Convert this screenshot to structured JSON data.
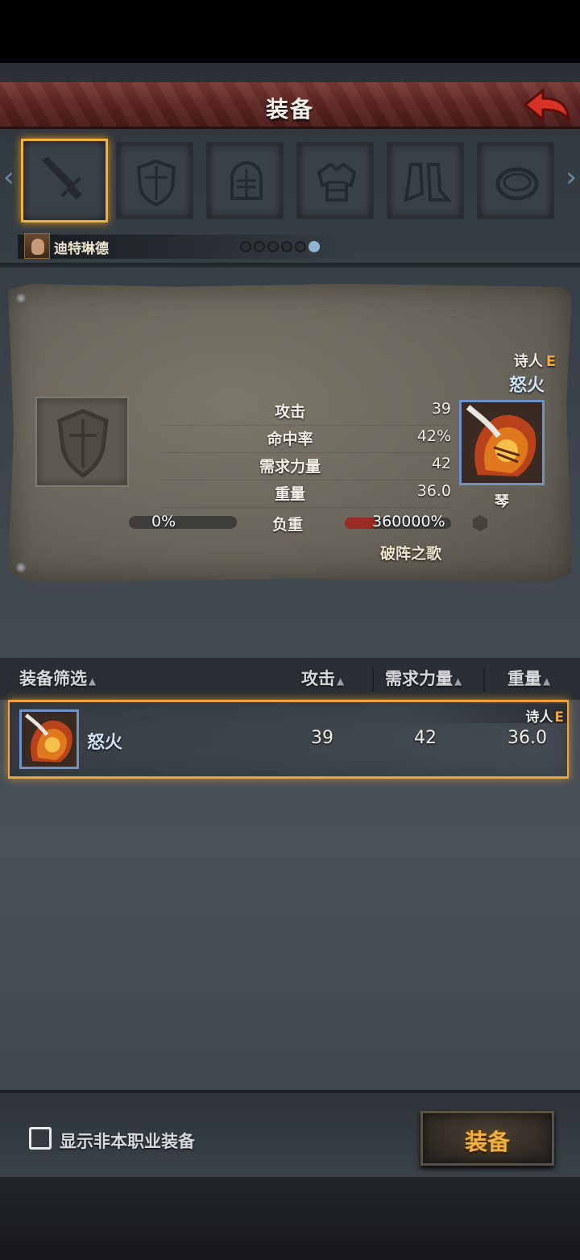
{
  "header": {
    "title": "装备",
    "back_icon": "back-arrow-icon"
  },
  "slots": [
    {
      "icon": "sword-icon",
      "active": true
    },
    {
      "icon": "shield-icon",
      "active": false
    },
    {
      "icon": "helmet-icon",
      "active": false
    },
    {
      "icon": "armor-icon",
      "active": false
    },
    {
      "icon": "boots-icon",
      "active": false
    },
    {
      "icon": "ring-icon",
      "active": false
    }
  ],
  "character": {
    "name": "迪特琳德",
    "page_dots": 6,
    "active_dot": 6
  },
  "detail": {
    "class_name": "诗人",
    "class_grade": "E",
    "item_name": "怒火",
    "item_type": "琴",
    "stats": [
      {
        "label": "攻击",
        "value": "39"
      },
      {
        "label": "命中率",
        "value": "42%"
      },
      {
        "label": "需求力量",
        "value": "42"
      },
      {
        "label": "重量",
        "value": "36.0"
      }
    ],
    "load": {
      "label": "负重",
      "current": "0%",
      "after": "360000%"
    },
    "set_name": "破阵之歌"
  },
  "list": {
    "headers": {
      "filter": "装备筛选",
      "attack": "攻击",
      "strength": "需求力量",
      "weight": "重量"
    },
    "rows": [
      {
        "class_name": "诗人",
        "class_grade": "E",
        "name": "怒火",
        "attack": "39",
        "strength": "42",
        "weight": "36.0"
      }
    ]
  },
  "footer": {
    "checkbox_label": "显示非本职业装备",
    "checked": false,
    "equip_button": "装备"
  },
  "colors": {
    "accent_gold": "#f0a33a",
    "item_name_blue": "#cfe3f7",
    "title_red": "#5c2522"
  }
}
